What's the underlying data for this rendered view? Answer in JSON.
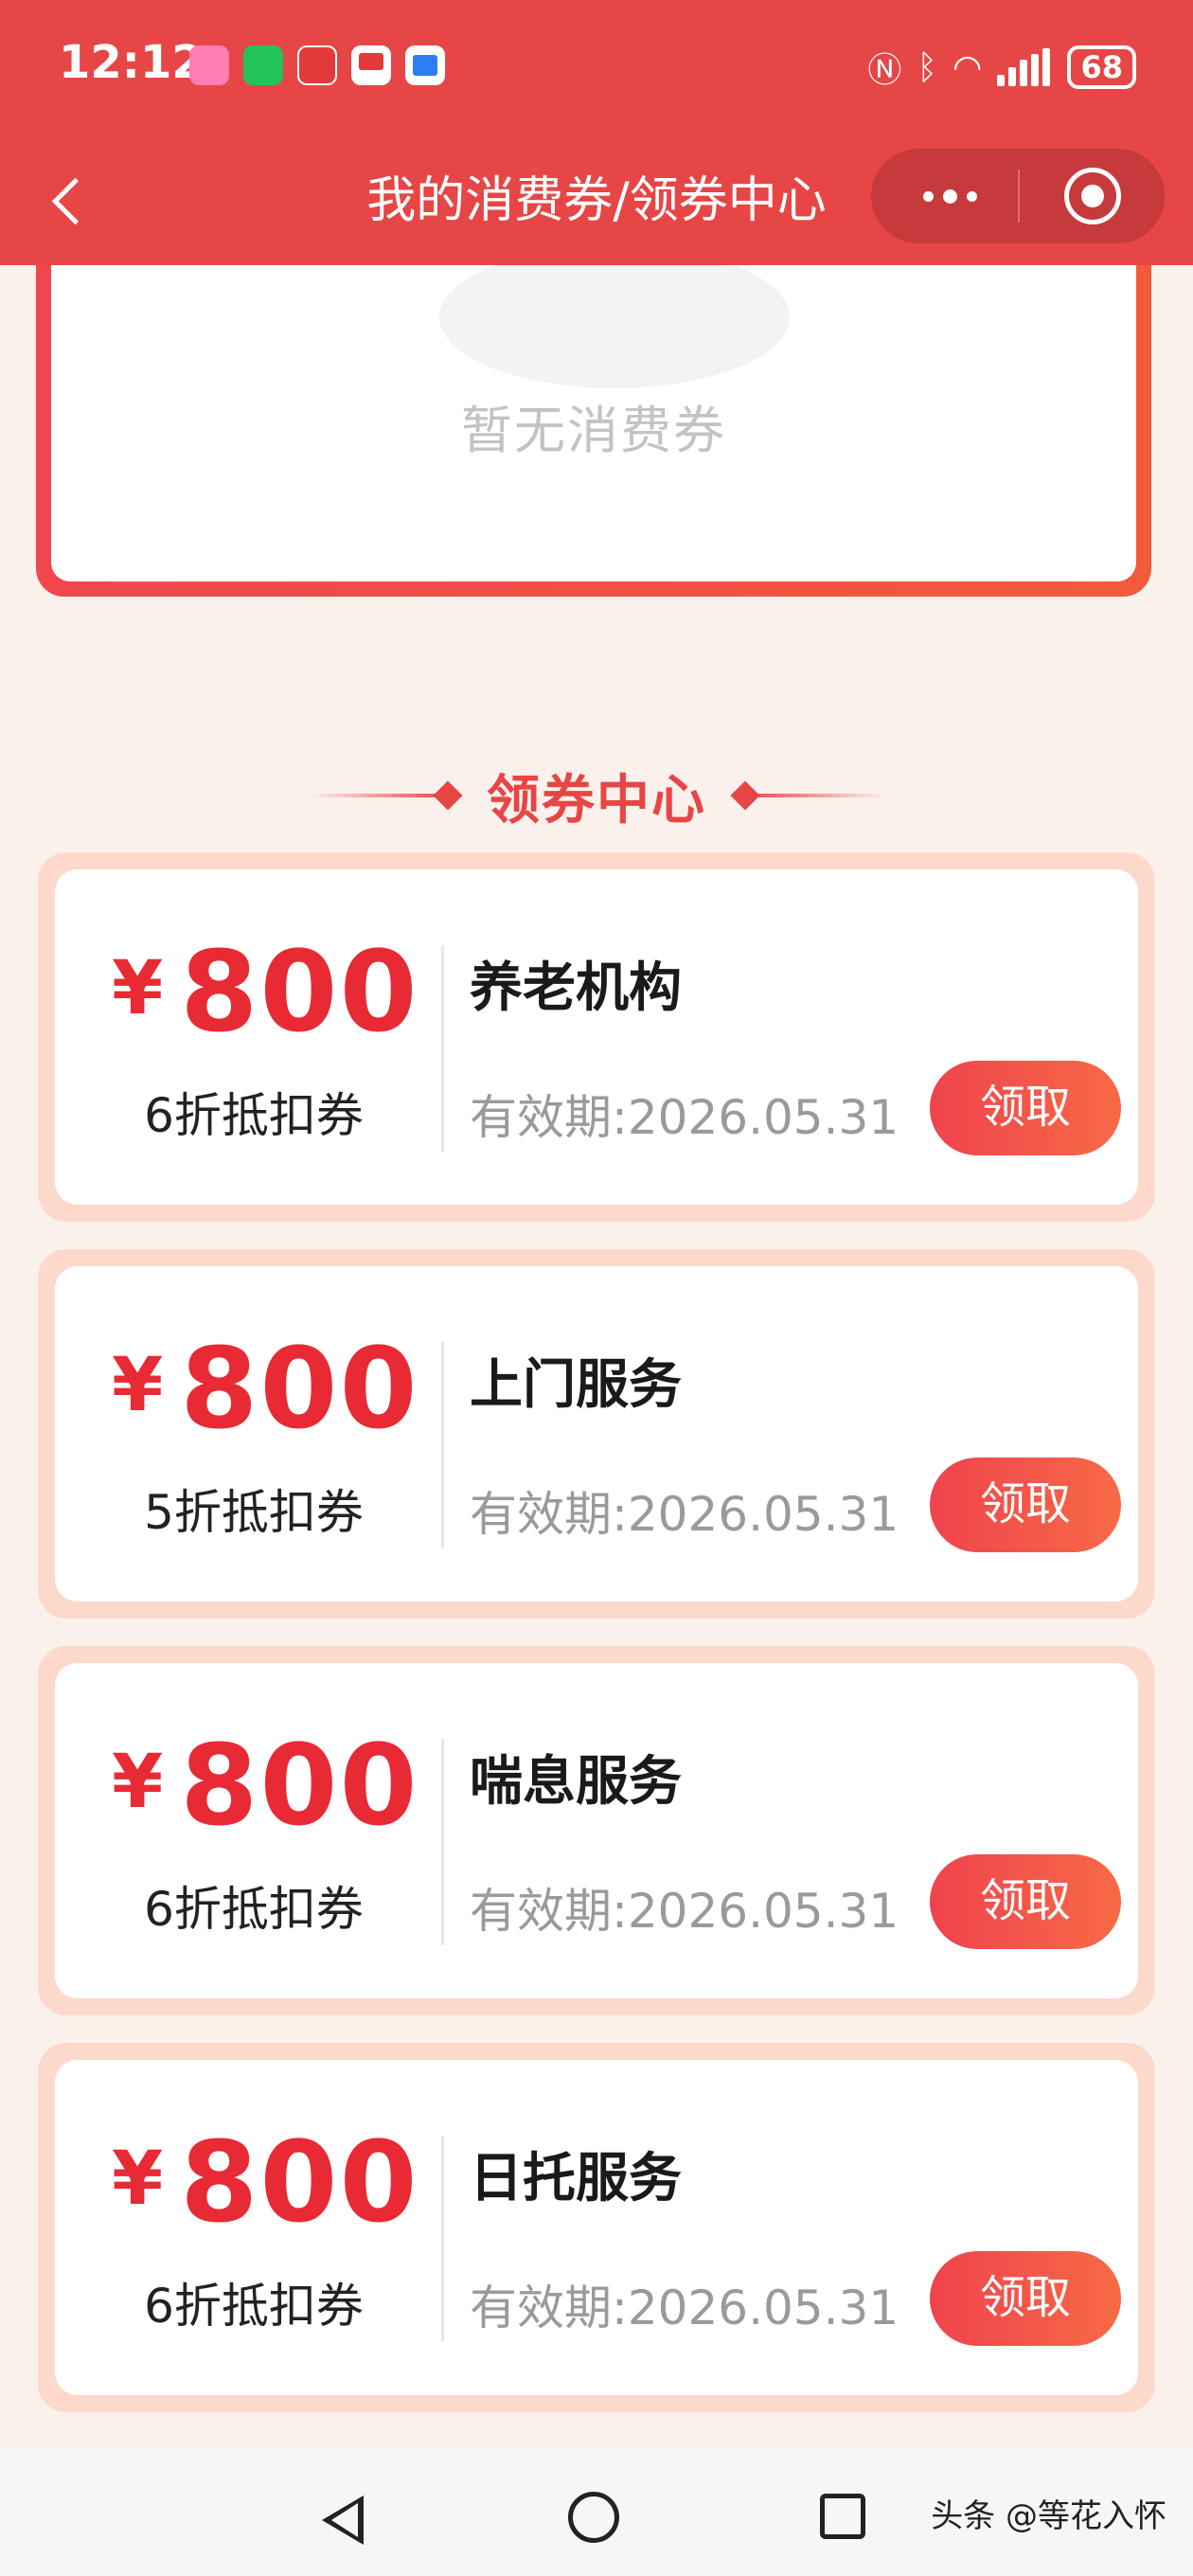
{
  "status_bar": {
    "time": "12:12",
    "battery": "68"
  },
  "header": {
    "title": "我的消费券/领券中心"
  },
  "empty_state": {
    "text": "暂无消费券"
  },
  "section": {
    "title": "领券中心"
  },
  "coupons": [
    {
      "currency": "¥",
      "amount": "800",
      "discount": "6折抵扣券",
      "service": "养老机构",
      "validity": "有效期:2026.05.31",
      "button": "领取"
    },
    {
      "currency": "¥",
      "amount": "800",
      "discount": "5折抵扣券",
      "service": "上门服务",
      "validity": "有效期:2026.05.31",
      "button": "领取"
    },
    {
      "currency": "¥",
      "amount": "800",
      "discount": "6折抵扣券",
      "service": "喘息服务",
      "validity": "有效期:2026.05.31",
      "button": "领取"
    },
    {
      "currency": "¥",
      "amount": "800",
      "discount": "6折抵扣券",
      "service": "日托服务",
      "validity": "有效期:2026.05.31",
      "button": "领取"
    }
  ],
  "watermark": "头条 @等花入怀",
  "colors": {
    "header_bg": "#e64646",
    "accent": "#e82a34",
    "button_gradient_start": "#f0434d",
    "button_gradient_end": "#f76a46"
  }
}
